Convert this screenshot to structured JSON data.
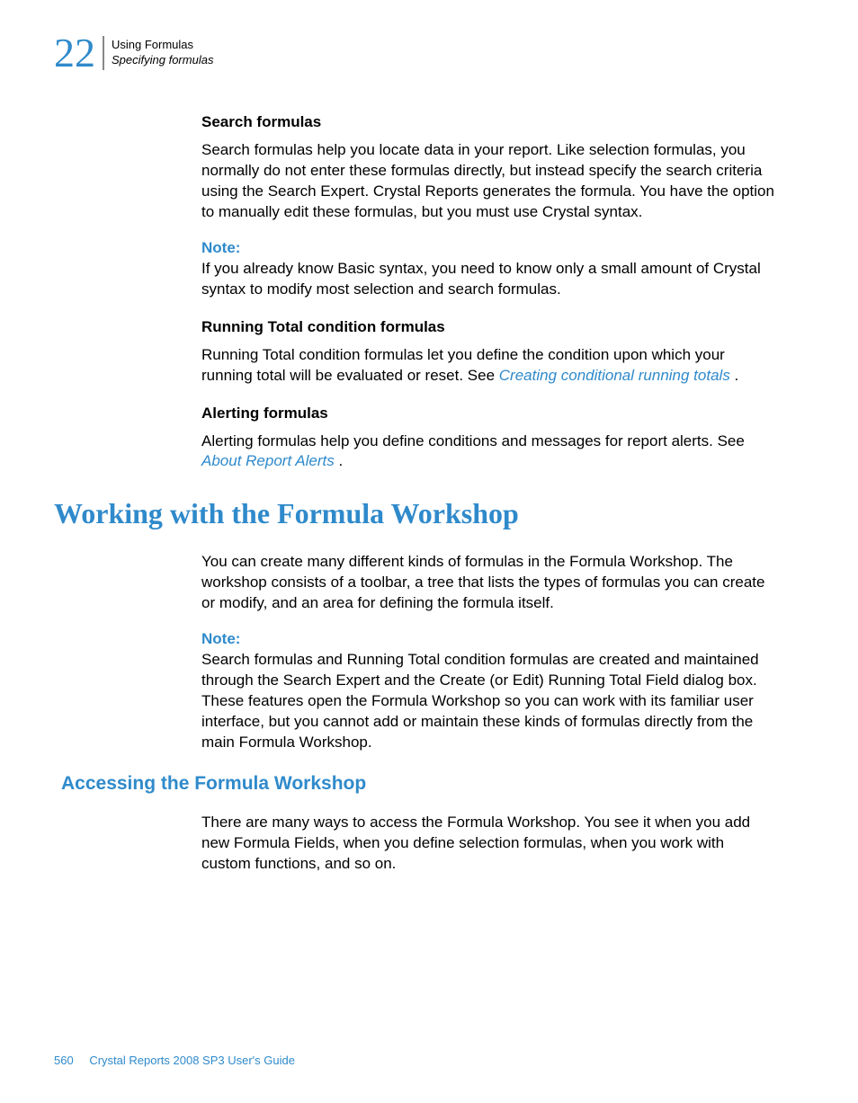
{
  "header": {
    "chapter_num": "22",
    "line1": "Using Formulas",
    "line2": "Specifying formulas"
  },
  "sections": {
    "search": {
      "heading": "Search formulas",
      "body": "Search formulas help you locate data in your report. Like selection formulas, you normally do not enter these formulas directly, but instead specify the search criteria using the Search Expert. Crystal Reports generates the formula. You have the option to manually edit these formulas, but you must use Crystal syntax.",
      "note_label": "Note:",
      "note_body": "If you already know Basic syntax, you need to know only a small amount of Crystal syntax to modify most selection and search formulas."
    },
    "running": {
      "heading": "Running Total condition formulas",
      "body_pre": "Running Total condition formulas let you define the condition upon which your running total will be evaluated or reset. See ",
      "link": "Creating conditional running totals",
      "body_post": " ."
    },
    "alerting": {
      "heading": "Alerting formulas",
      "body_pre": "Alerting formulas help you define conditions and messages for report alerts. See ",
      "link": "About Report Alerts",
      "body_post": " ."
    },
    "workshop": {
      "heading": "Working with the Formula Workshop",
      "body": "You can create many different kinds of formulas in the Formula Workshop. The workshop consists of a toolbar, a tree that lists the types of formulas you can create or modify, and an area for defining the formula itself.",
      "note_label": "Note:",
      "note_body": "Search formulas and Running Total condition formulas are created and maintained through the Search Expert and the Create (or Edit) Running Total Field dialog box. These features open the Formula Workshop so you can work with its familiar user interface, but you cannot add or maintain these kinds of formulas directly from the main Formula Workshop."
    },
    "accessing": {
      "heading": "Accessing the Formula Workshop",
      "body": "There are many ways to access the Formula Workshop. You see it when you add new Formula Fields, when you define selection formulas, when you work with custom functions, and so on."
    }
  },
  "footer": {
    "page": "560",
    "title": "Crystal Reports 2008 SP3 User's Guide"
  }
}
